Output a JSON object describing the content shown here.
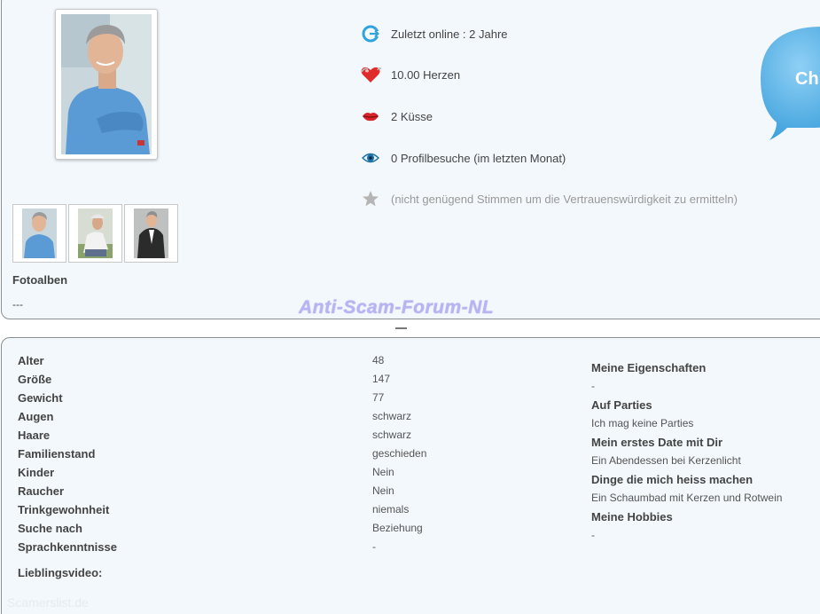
{
  "profile": {
    "main_photo_alt": "profile-photo",
    "thumbnails": [
      "thumb-1",
      "thumb-2",
      "thumb-3"
    ],
    "fotoalben_label": "Fotoalben",
    "fotoalben_value": "---"
  },
  "watermark": "Anti-Scam-Forum-NL",
  "stats": {
    "online": "Zuletzt online : 2 Jahre",
    "hearts": "10.00 Herzen",
    "kisses": "2 Küsse",
    "visits": "0 Profilbesuche (im letzten Monat)",
    "trust": "(nicht genügend Stimmen um die Vertrauenswürdigkeit zu ermitteln)"
  },
  "chat": {
    "label": "Ch"
  },
  "attributes": [
    {
      "label": "Alter",
      "value": "48"
    },
    {
      "label": "Größe",
      "value": "147"
    },
    {
      "label": "Gewicht",
      "value": "77"
    },
    {
      "label": "Augen",
      "value": "schwarz"
    },
    {
      "label": "Haare",
      "value": "schwarz"
    },
    {
      "label": "Familienstand",
      "value": "geschieden"
    },
    {
      "label": "Kinder",
      "value": "Nein"
    },
    {
      "label": "Raucher",
      "value": "Nein"
    },
    {
      "label": "Trinkgewohnheit",
      "value": "niemals"
    },
    {
      "label": "Suche nach",
      "value": "Beziehung"
    },
    {
      "label": "Sprachkenntnisse",
      "value": "-"
    }
  ],
  "favorite_video_label": "Lieblingsvideo:",
  "right_column": [
    {
      "heading": "Meine Eigenschaften",
      "value": "-"
    },
    {
      "heading": "Auf Parties",
      "value": "Ich mag keine Parties"
    },
    {
      "heading": "Mein erstes Date mit Dir",
      "value": "Ein Abendessen bei Kerzenlicht"
    },
    {
      "heading": "Dinge die mich heiss machen",
      "value": "Ein Schaumbad mit Kerzen und Rotwein"
    },
    {
      "heading": "Meine Hobbies",
      "value": "-"
    }
  ],
  "footer_watermark": "Scamerslist.de",
  "colors": {
    "panel_bg": "#f2f8fc",
    "chat_bubble": "#5cb3e6",
    "watermark": "#b8b4f4"
  }
}
